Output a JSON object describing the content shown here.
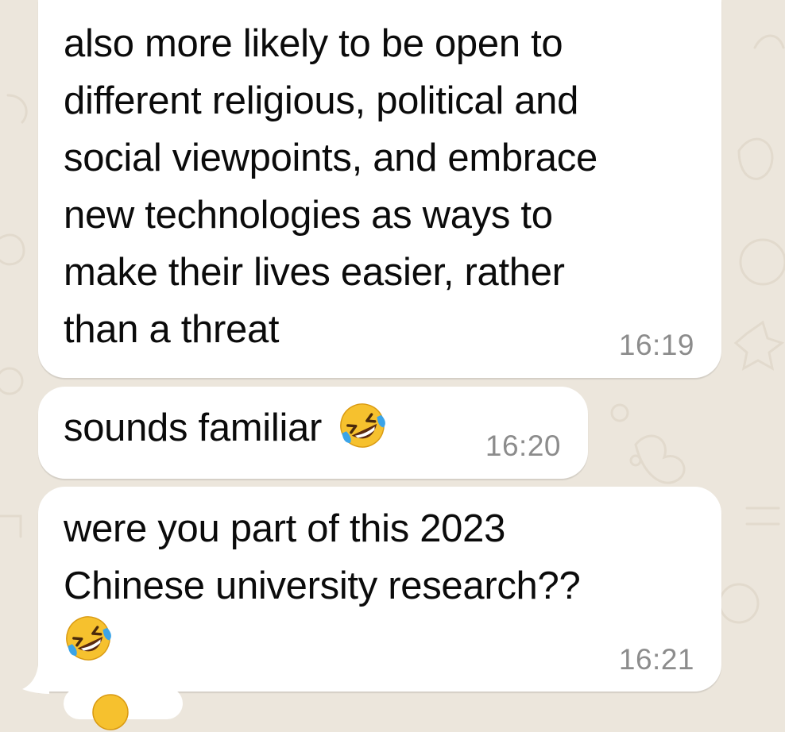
{
  "colors": {
    "wallpaper": "#ece6dc",
    "bubble": "#ffffff",
    "message_text": "#0b0b0b",
    "timestamp": "#8c8c8c",
    "emoji_face": "#f6c12e",
    "emoji_tear": "#3ba4e8"
  },
  "messages": [
    {
      "lines": [
        "also more likely to be open to",
        "different religious, political and",
        "social viewpoints, and embrace",
        "new technologies as ways to",
        "make their lives easier, rather",
        "than a threat"
      ],
      "time": "16:19"
    },
    {
      "text": "sounds familiar",
      "emoji": "rolling-on-the-floor-laughing-emoji",
      "time": "16:20"
    },
    {
      "lines": [
        "were you part of this 2023",
        "Chinese university research??"
      ],
      "emoji": "rolling-on-the-floor-laughing-emoji",
      "time": "16:21"
    }
  ]
}
